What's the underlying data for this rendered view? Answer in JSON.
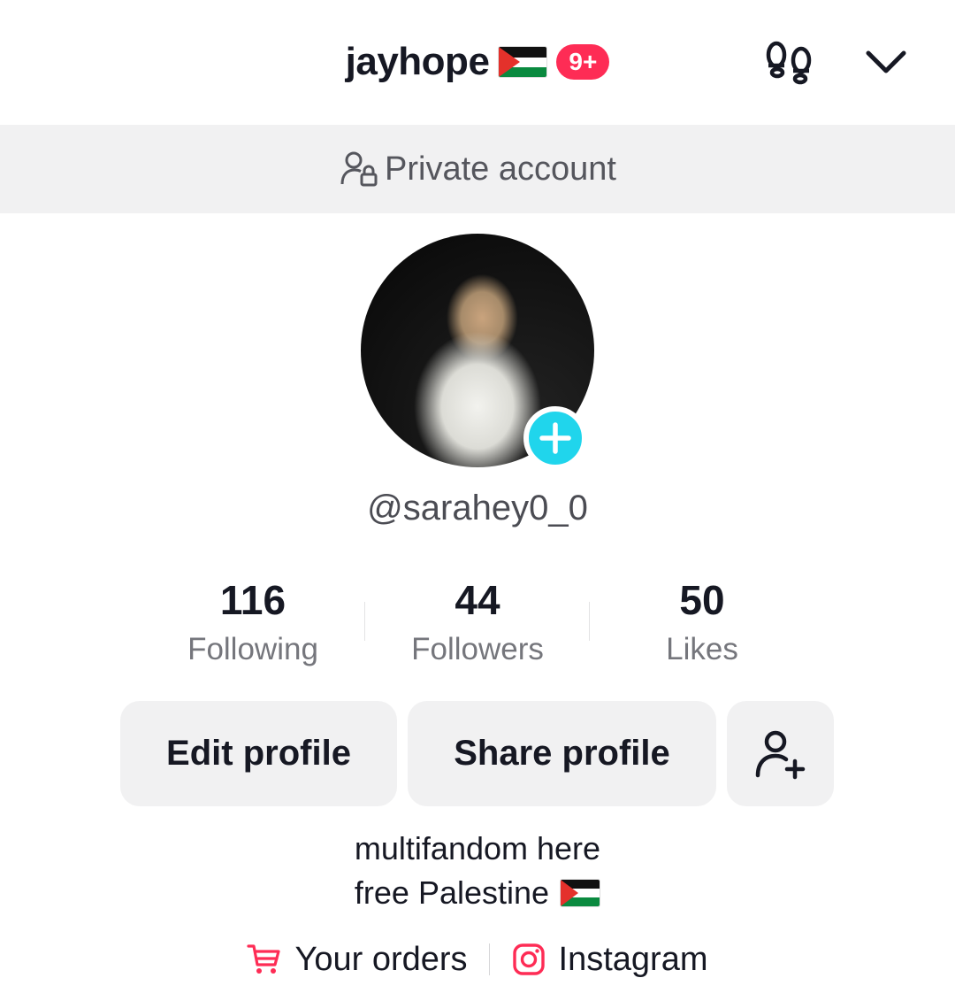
{
  "header": {
    "username": "jayhope",
    "notification_badge": "9+",
    "badge_color": "#fe2c55",
    "icons": [
      "flag-palestine-icon",
      "footprints-icon",
      "chevron-down-icon"
    ]
  },
  "private_banner": {
    "icon": "person-lock-icon",
    "text": "Private account"
  },
  "profile": {
    "handle": "@sarahey0_0",
    "avatar_add_color": "#20d5ec"
  },
  "stats": [
    {
      "value": "116",
      "label": "Following"
    },
    {
      "value": "44",
      "label": "Followers"
    },
    {
      "value": "50",
      "label": "Likes"
    }
  ],
  "actions": {
    "edit_label": "Edit profile",
    "share_label": "Share profile",
    "add_friend_icon": "add-person-icon"
  },
  "bio": {
    "line1": "multifandom here",
    "line2": "free Palestine"
  },
  "links": {
    "orders_label": "Your orders",
    "instagram_label": "Instagram",
    "accent": "#fe2c55"
  }
}
